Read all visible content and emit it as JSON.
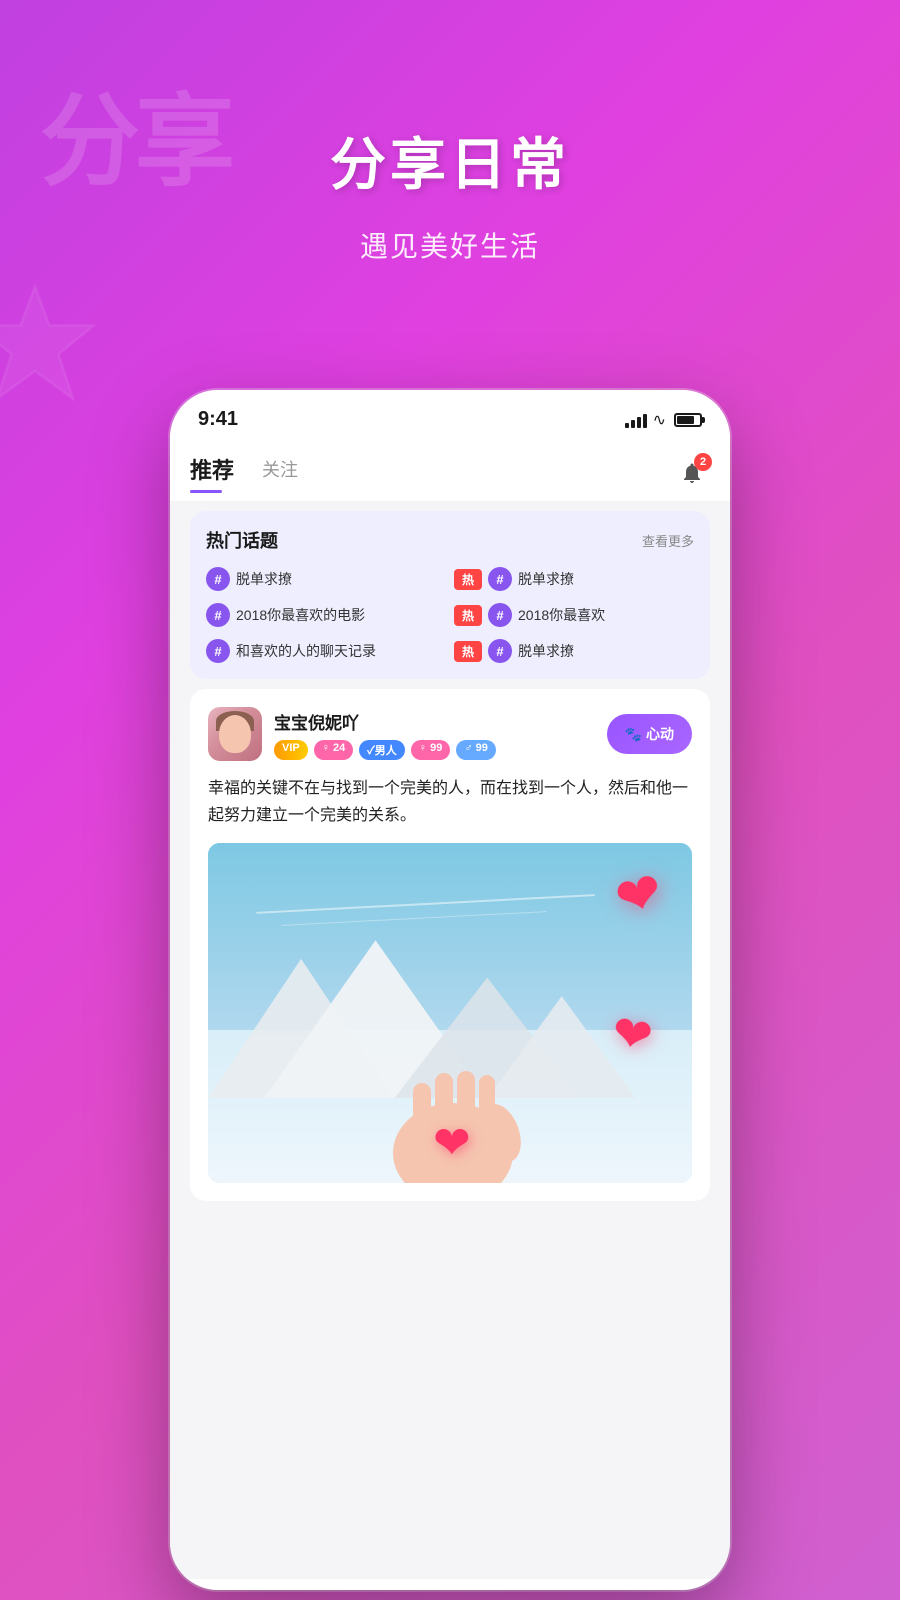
{
  "background": {
    "gradient_start": "#c040e0",
    "gradient_end": "#d060d0"
  },
  "header": {
    "watermark_text": "分享",
    "main_title": "分享日常",
    "subtitle": "遇见美好生活"
  },
  "status_bar": {
    "time": "9:41",
    "battery_label": "battery",
    "signal_label": "signal",
    "wifi_label": "wifi"
  },
  "tabs": {
    "active_tab": "推荐",
    "secondary_tab": "关注",
    "bell_badge": "2"
  },
  "hot_topics": {
    "title": "热门话题",
    "more_label": "查看更多",
    "topics": [
      {
        "text": "脱单求撩",
        "hot": false
      },
      {
        "text": "脱单求撩",
        "hot": true
      },
      {
        "text": "2018你最喜欢的电影",
        "hot": false
      },
      {
        "text": "2018你最喜欢",
        "hot": true
      },
      {
        "text": "和喜欢的人的聊天记录",
        "hot": false
      },
      {
        "text": "脱单求撩",
        "hot": true
      }
    ]
  },
  "post": {
    "username": "宝宝倪妮吖",
    "tags": {
      "vip": "VIP",
      "gender": "♀ 24",
      "match": "✓男人",
      "score_f": "♀ 99",
      "score_m": "♂ 99"
    },
    "heart_button": "心动",
    "content": "幸福的关键不在与找到一个完美的人，而在找到一个人，然后和他一起努力建立一个完美的关系。"
  }
}
